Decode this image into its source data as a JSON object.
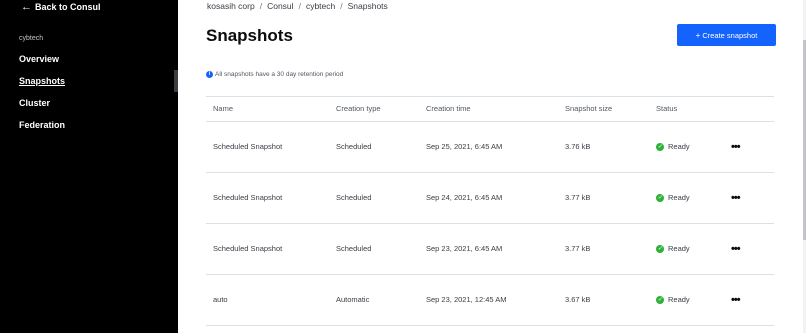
{
  "sidebar": {
    "back_label": "Back to Consul",
    "org": "cybtech",
    "items": [
      {
        "label": "Overview",
        "active": false
      },
      {
        "label": "Snapshots",
        "active": true
      },
      {
        "label": "Cluster",
        "active": false
      },
      {
        "label": "Federation",
        "active": false
      }
    ]
  },
  "breadcrumb": [
    "kosasih corp",
    "Consul",
    "cybtech",
    "Snapshots"
  ],
  "page": {
    "title": "Snapshots",
    "create_button": "Create snapshot",
    "notice": "All snapshots have a 30 day retention period"
  },
  "table": {
    "columns": [
      "Name",
      "Creation type",
      "Creation time",
      "Snapshot size",
      "Status"
    ],
    "rows": [
      {
        "name": "Scheduled Snapshot",
        "type": "Scheduled",
        "time": "Sep 25, 2021, 6:45 AM",
        "size": "3.76 kB",
        "status": "Ready"
      },
      {
        "name": "Scheduled Snapshot",
        "type": "Scheduled",
        "time": "Sep 24, 2021, 6:45 AM",
        "size": "3.77 kB",
        "status": "Ready"
      },
      {
        "name": "Scheduled Snapshot",
        "type": "Scheduled",
        "time": "Sep 23, 2021, 6:45 AM",
        "size": "3.77 kB",
        "status": "Ready"
      },
      {
        "name": "auto",
        "type": "Automatic",
        "time": "Sep 23, 2021, 12:45 AM",
        "size": "3.67 kB",
        "status": "Ready"
      }
    ]
  },
  "colors": {
    "accent": "#1563ff",
    "ready": "#2eb039",
    "sidebar_bg": "#000000"
  }
}
